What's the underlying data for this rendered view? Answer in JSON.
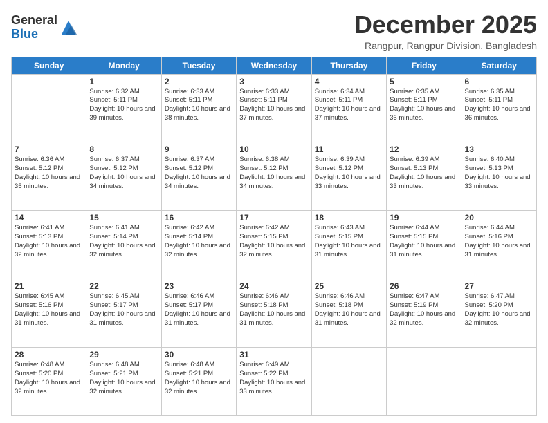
{
  "header": {
    "logo_general": "General",
    "logo_blue": "Blue",
    "month_title": "December 2025",
    "subtitle": "Rangpur, Rangpur Division, Bangladesh"
  },
  "weekdays": [
    "Sunday",
    "Monday",
    "Tuesday",
    "Wednesday",
    "Thursday",
    "Friday",
    "Saturday"
  ],
  "weeks": [
    [
      {
        "day": "",
        "info": ""
      },
      {
        "day": "1",
        "info": "Sunrise: 6:32 AM\nSunset: 5:11 PM\nDaylight: 10 hours and 39 minutes."
      },
      {
        "day": "2",
        "info": "Sunrise: 6:33 AM\nSunset: 5:11 PM\nDaylight: 10 hours and 38 minutes."
      },
      {
        "day": "3",
        "info": "Sunrise: 6:33 AM\nSunset: 5:11 PM\nDaylight: 10 hours and 37 minutes."
      },
      {
        "day": "4",
        "info": "Sunrise: 6:34 AM\nSunset: 5:11 PM\nDaylight: 10 hours and 37 minutes."
      },
      {
        "day": "5",
        "info": "Sunrise: 6:35 AM\nSunset: 5:11 PM\nDaylight: 10 hours and 36 minutes."
      },
      {
        "day": "6",
        "info": "Sunrise: 6:35 AM\nSunset: 5:11 PM\nDaylight: 10 hours and 36 minutes."
      }
    ],
    [
      {
        "day": "7",
        "info": "Sunrise: 6:36 AM\nSunset: 5:12 PM\nDaylight: 10 hours and 35 minutes."
      },
      {
        "day": "8",
        "info": "Sunrise: 6:37 AM\nSunset: 5:12 PM\nDaylight: 10 hours and 34 minutes."
      },
      {
        "day": "9",
        "info": "Sunrise: 6:37 AM\nSunset: 5:12 PM\nDaylight: 10 hours and 34 minutes."
      },
      {
        "day": "10",
        "info": "Sunrise: 6:38 AM\nSunset: 5:12 PM\nDaylight: 10 hours and 34 minutes."
      },
      {
        "day": "11",
        "info": "Sunrise: 6:39 AM\nSunset: 5:12 PM\nDaylight: 10 hours and 33 minutes."
      },
      {
        "day": "12",
        "info": "Sunrise: 6:39 AM\nSunset: 5:13 PM\nDaylight: 10 hours and 33 minutes."
      },
      {
        "day": "13",
        "info": "Sunrise: 6:40 AM\nSunset: 5:13 PM\nDaylight: 10 hours and 33 minutes."
      }
    ],
    [
      {
        "day": "14",
        "info": "Sunrise: 6:41 AM\nSunset: 5:13 PM\nDaylight: 10 hours and 32 minutes."
      },
      {
        "day": "15",
        "info": "Sunrise: 6:41 AM\nSunset: 5:14 PM\nDaylight: 10 hours and 32 minutes."
      },
      {
        "day": "16",
        "info": "Sunrise: 6:42 AM\nSunset: 5:14 PM\nDaylight: 10 hours and 32 minutes."
      },
      {
        "day": "17",
        "info": "Sunrise: 6:42 AM\nSunset: 5:15 PM\nDaylight: 10 hours and 32 minutes."
      },
      {
        "day": "18",
        "info": "Sunrise: 6:43 AM\nSunset: 5:15 PM\nDaylight: 10 hours and 31 minutes."
      },
      {
        "day": "19",
        "info": "Sunrise: 6:44 AM\nSunset: 5:15 PM\nDaylight: 10 hours and 31 minutes."
      },
      {
        "day": "20",
        "info": "Sunrise: 6:44 AM\nSunset: 5:16 PM\nDaylight: 10 hours and 31 minutes."
      }
    ],
    [
      {
        "day": "21",
        "info": "Sunrise: 6:45 AM\nSunset: 5:16 PM\nDaylight: 10 hours and 31 minutes."
      },
      {
        "day": "22",
        "info": "Sunrise: 6:45 AM\nSunset: 5:17 PM\nDaylight: 10 hours and 31 minutes."
      },
      {
        "day": "23",
        "info": "Sunrise: 6:46 AM\nSunset: 5:17 PM\nDaylight: 10 hours and 31 minutes."
      },
      {
        "day": "24",
        "info": "Sunrise: 6:46 AM\nSunset: 5:18 PM\nDaylight: 10 hours and 31 minutes."
      },
      {
        "day": "25",
        "info": "Sunrise: 6:46 AM\nSunset: 5:18 PM\nDaylight: 10 hours and 31 minutes."
      },
      {
        "day": "26",
        "info": "Sunrise: 6:47 AM\nSunset: 5:19 PM\nDaylight: 10 hours and 32 minutes."
      },
      {
        "day": "27",
        "info": "Sunrise: 6:47 AM\nSunset: 5:20 PM\nDaylight: 10 hours and 32 minutes."
      }
    ],
    [
      {
        "day": "28",
        "info": "Sunrise: 6:48 AM\nSunset: 5:20 PM\nDaylight: 10 hours and 32 minutes."
      },
      {
        "day": "29",
        "info": "Sunrise: 6:48 AM\nSunset: 5:21 PM\nDaylight: 10 hours and 32 minutes."
      },
      {
        "day": "30",
        "info": "Sunrise: 6:48 AM\nSunset: 5:21 PM\nDaylight: 10 hours and 32 minutes."
      },
      {
        "day": "31",
        "info": "Sunrise: 6:49 AM\nSunset: 5:22 PM\nDaylight: 10 hours and 33 minutes."
      },
      {
        "day": "",
        "info": ""
      },
      {
        "day": "",
        "info": ""
      },
      {
        "day": "",
        "info": ""
      }
    ]
  ]
}
